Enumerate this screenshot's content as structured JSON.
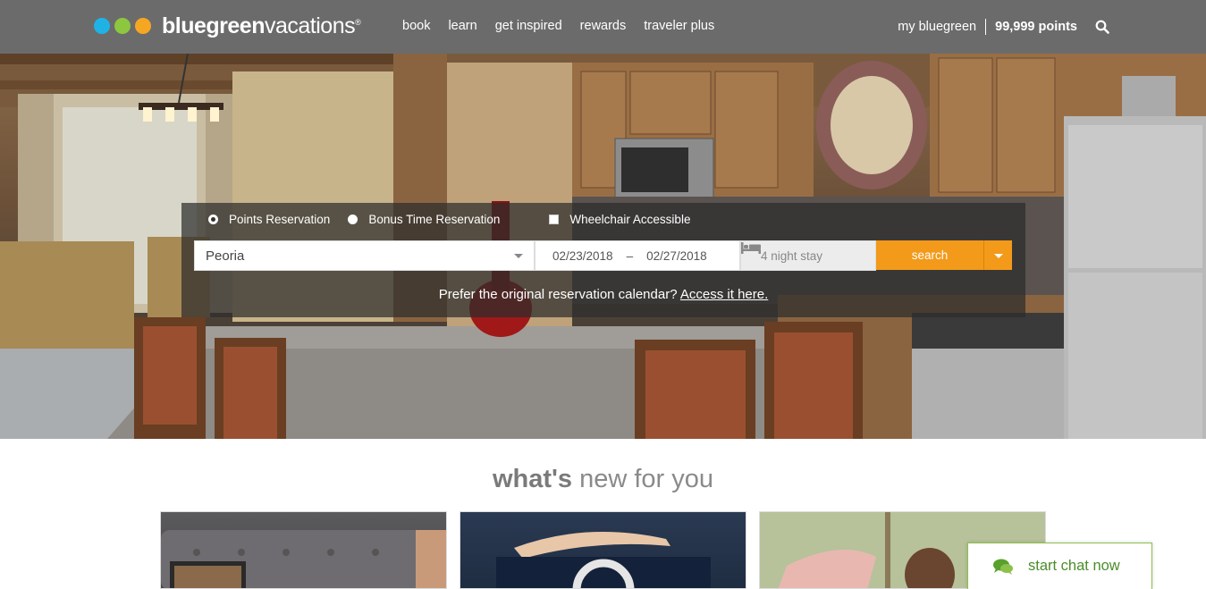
{
  "header": {
    "logo": {
      "bold": "bluegreen",
      "light": "vacations",
      "reg": "®",
      "dot_colors": [
        "#1fb3e5",
        "#8dc63f",
        "#f5a623"
      ]
    },
    "nav": [
      "book",
      "learn",
      "get inspired",
      "rewards",
      "traveler plus"
    ],
    "account_label": "my bluegreen",
    "points": "99,999 points",
    "search_icon": "search-icon"
  },
  "reservation": {
    "options": [
      "Points Reservation",
      "Bonus Time Reservation",
      "Wheelchair Accessible"
    ],
    "selected_option": "Points Reservation",
    "location": "Peoria",
    "check_in": "02/23/2018",
    "date_separator": "–",
    "check_out": "02/27/2018",
    "stay": "4 night stay",
    "search_label": "search",
    "prefer_text": "Prefer the original reservation calendar? ",
    "prefer_link": "Access it here.",
    "accent_color": "#f39a1a"
  },
  "whats_new": {
    "bold": "what's",
    "rest": " new for you"
  },
  "chat": {
    "label": "start chat now",
    "color": "#4a8d2a"
  }
}
